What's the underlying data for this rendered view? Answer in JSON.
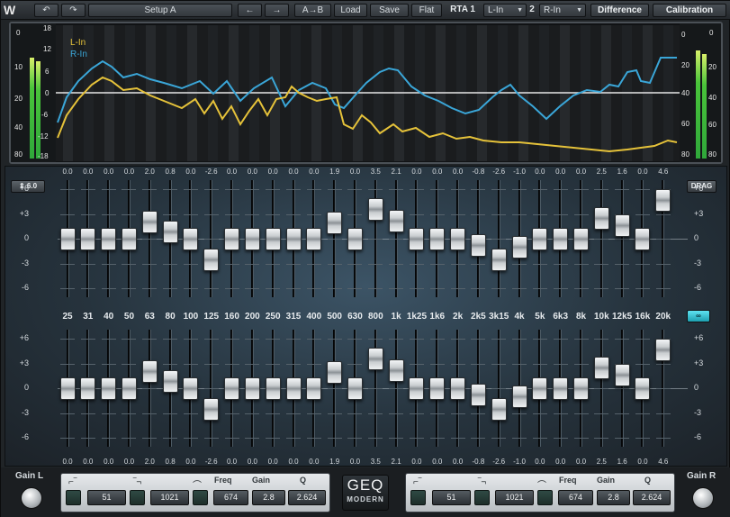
{
  "toolbar": {
    "undo_icon": "undo-icon",
    "redo_icon": "redo-icon",
    "preset": "Setup A",
    "prev_icon": "arrow-left-icon",
    "next_icon": "arrow-right-icon",
    "ab": "A→B",
    "load": "Load",
    "save": "Save",
    "flat": "Flat",
    "rta1_label": "RTA 1",
    "rta1_value": "L-In",
    "rta2_label": "2",
    "rta2_value": "R-In",
    "difference": "Difference",
    "calibration": "Calibration"
  },
  "rta": {
    "legend": [
      {
        "name": "L-In",
        "color": "#e5c23a"
      },
      {
        "name": "R-In",
        "color": "#3aa6d8"
      }
    ],
    "left_meter_scale": [
      "0",
      "10",
      "20",
      "40",
      "80"
    ],
    "right_meter_scale": [
      "0",
      "20",
      "40",
      "60",
      "80"
    ],
    "left_plot_scale": [
      "18",
      "12",
      "6",
      "0",
      "-6",
      "-12",
      "-18"
    ],
    "right_plot_scale": [
      "0",
      "20",
      "40",
      "60",
      "80"
    ]
  },
  "eq": {
    "range_value": "6.0",
    "drag": "DRAG",
    "link_icon": "link-icon",
    "scale": [
      "+6",
      "+3",
      "0",
      "-3",
      "-6"
    ],
    "bands": [
      "25",
      "31",
      "40",
      "50",
      "63",
      "80",
      "100",
      "125",
      "160",
      "200",
      "250",
      "315",
      "400",
      "500",
      "630",
      "800",
      "1k",
      "1k25",
      "1k6",
      "2k",
      "2k5",
      "3k15",
      "4k",
      "5k",
      "6k3",
      "8k",
      "10k",
      "12k5",
      "16k",
      "20k"
    ],
    "top_values": [
      "0.0",
      "0.0",
      "0.0",
      "0.0",
      "2.0",
      "0.8",
      "0.0",
      "-2.6",
      "0.0",
      "0.0",
      "0.0",
      "0.0",
      "0.0",
      "1.9",
      "0.0",
      "3.5",
      "2.1",
      "0.0",
      "0.0",
      "0.0",
      "-0.8",
      "-2.6",
      "-1.0",
      "0.0",
      "0.0",
      "0.0",
      "2.5",
      "1.6",
      "0.0",
      "4.6"
    ],
    "bottom_values": [
      "0.0",
      "0.0",
      "0.0",
      "0.0",
      "2.0",
      "0.8",
      "0.0",
      "-2.6",
      "0.0",
      "0.0",
      "0.0",
      "0.0",
      "0.0",
      "1.9",
      "0.0",
      "3.5",
      "2.1",
      "0.0",
      "0.0",
      "0.0",
      "-0.8",
      "-2.6",
      "-1.0",
      "0.0",
      "0.0",
      "0.0",
      "2.5",
      "1.6",
      "0.0",
      "4.6"
    ]
  },
  "bottom": {
    "gain_l": "Gain L",
    "gain_r": "Gain R",
    "logo_title": "GEQ",
    "logo_sub": "MODERN",
    "left": {
      "lowcut": "51",
      "highcut": "1021",
      "freq_label": "Freq",
      "gain_label": "Gain",
      "q_label": "Q",
      "freq": "674",
      "gain": "2.8",
      "q": "2.624"
    },
    "right": {
      "lowcut": "51",
      "highcut": "1021",
      "freq_label": "Freq",
      "gain_label": "Gain",
      "q_label": "Q",
      "freq": "674",
      "gain": "2.8",
      "q": "2.624"
    }
  }
}
